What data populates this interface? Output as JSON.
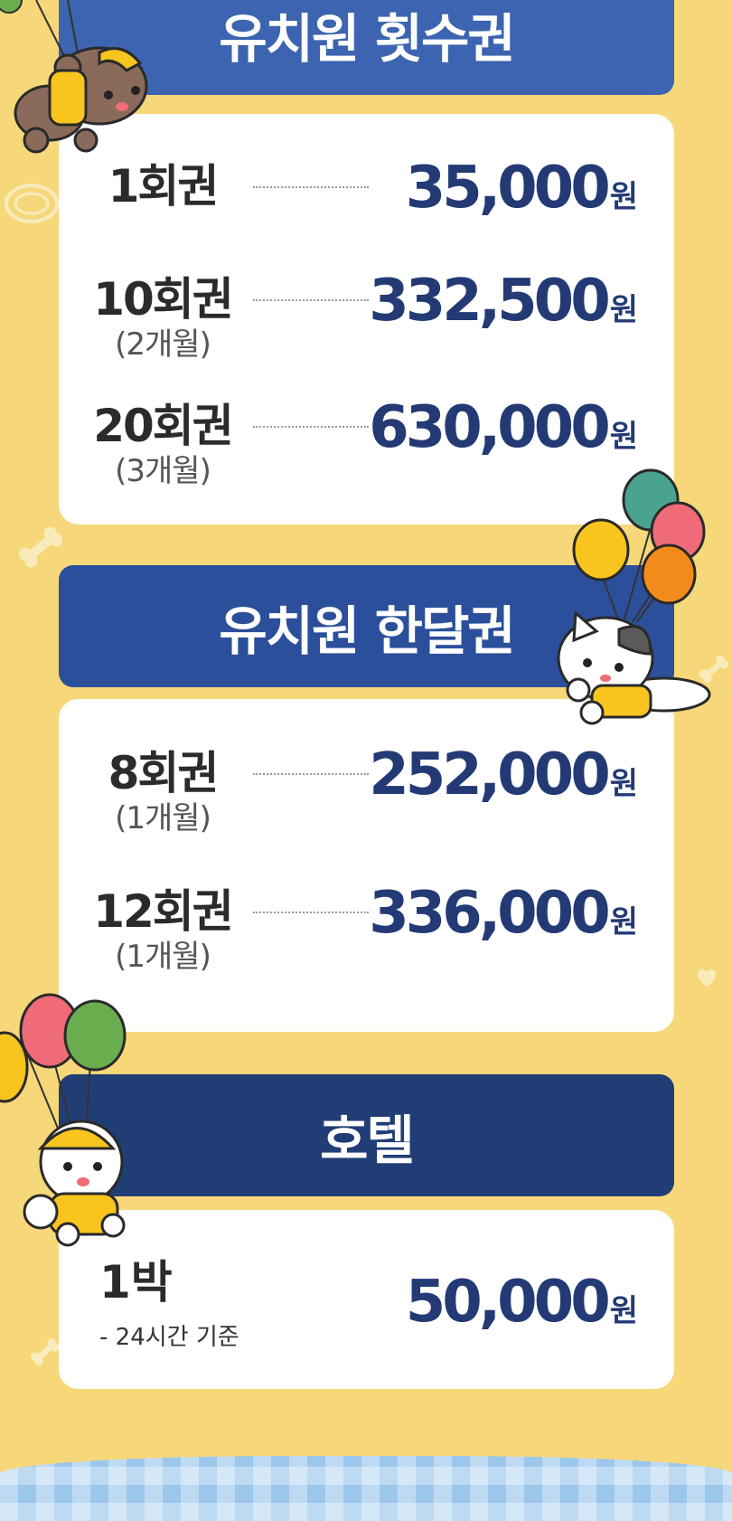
{
  "sections": [
    {
      "title": "유치원 횟수권",
      "color": "#3c64b0",
      "rows": [
        {
          "name": "1회권",
          "sub": "",
          "amount": "35,000",
          "unit": "원"
        },
        {
          "name": "10회권",
          "sub": "(2개월)",
          "amount": "332,500",
          "unit": "원"
        },
        {
          "name": "20회권",
          "sub": "(3개월)",
          "amount": "630,000",
          "unit": "원"
        }
      ]
    },
    {
      "title": "유치원 한달권",
      "color": "#2b4f9a",
      "rows": [
        {
          "name": "8회권",
          "sub": "(1개월)",
          "amount": "252,000",
          "unit": "원"
        },
        {
          "name": "12회권",
          "sub": "(1개월)",
          "amount": "336,000",
          "unit": "원"
        }
      ]
    },
    {
      "title": "호텔",
      "color": "#213d75",
      "rows": [
        {
          "name": "1박",
          "sub": "- 24시간 기준",
          "amount": "50,000",
          "unit": "원"
        }
      ]
    }
  ],
  "colors": {
    "background": "#f6d87a",
    "price_text": "#233a75",
    "balloon_teal": "#4aa38f",
    "balloon_pink": "#f06b78",
    "balloon_yellow": "#f7c51e",
    "balloon_orange": "#f28b1a",
    "balloon_green": "#6aad4f"
  },
  "icons": [
    "balloon-icon",
    "teddy-bear-mascot",
    "cat-mascot",
    "white-dog-mascot",
    "bone-icon",
    "collar-icon"
  ]
}
